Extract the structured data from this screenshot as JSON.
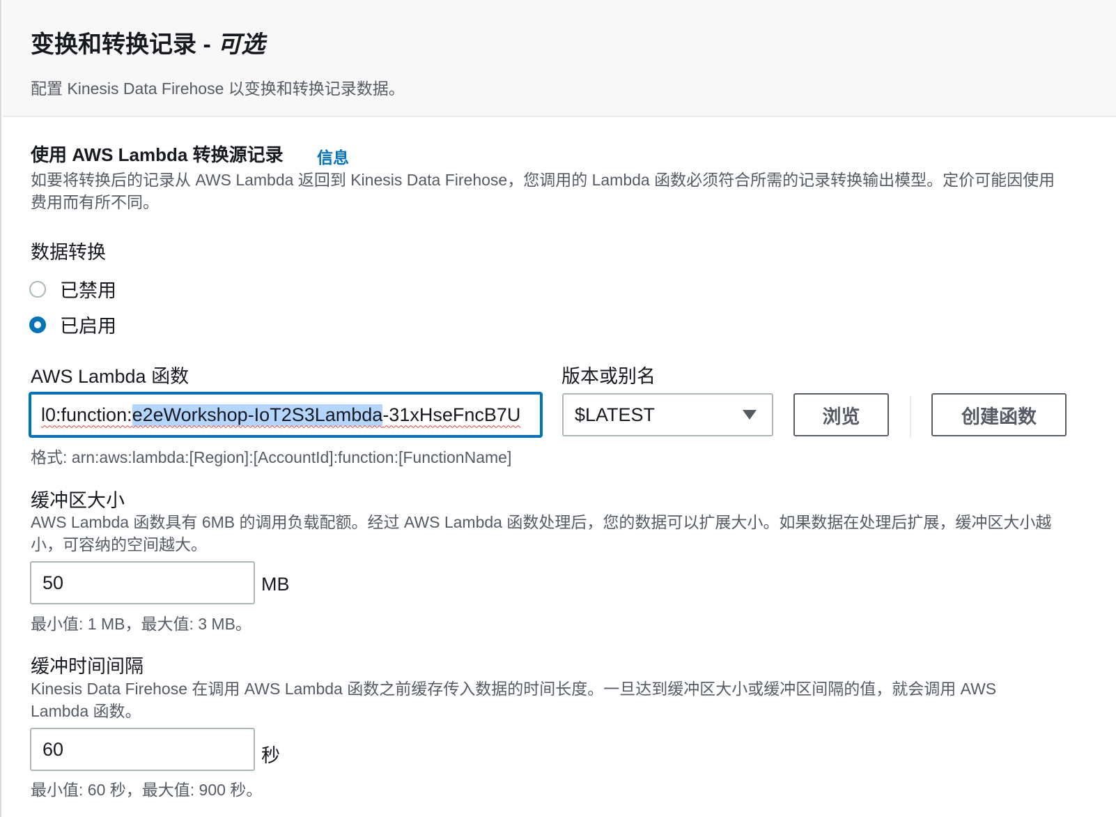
{
  "header": {
    "title": "变换和转换记录 - ",
    "title_optional": "可选",
    "description": "配置 Kinesis Data Firehose 以变换和转换记录数据。"
  },
  "lambda_section": {
    "title": "使用 AWS Lambda 转换源记录",
    "info_link": "信息",
    "description": "如要将转换后的记录从 AWS Lambda 返回到 Kinesis Data Firehose，您调用的 Lambda 函数必须符合所需的记录转换输出模型。定价可能因使用费用而有所不同。"
  },
  "data_transformation": {
    "label": "数据转换",
    "options": [
      {
        "label": "已禁用",
        "checked": false
      },
      {
        "label": "已启用",
        "checked": true
      }
    ]
  },
  "lambda_function": {
    "label": "AWS Lambda 函数",
    "value_prefix": "l0:function:",
    "value_selected": "e2eWorkshop-IoT2S3Lambda",
    "value_suffix": "-31xHseFncB7U",
    "hint": "格式: arn:aws:lambda:[Region]:[AccountId]:function:[FunctionName]"
  },
  "version": {
    "label": "版本或别名",
    "selected": "$LATEST"
  },
  "buttons": {
    "browse": "浏览",
    "create_function": "创建函数"
  },
  "buffer_size": {
    "label": "缓冲区大小",
    "description": "AWS Lambda 函数具有 6MB 的调用负载配额。经过 AWS Lambda 函数处理后，您的数据可以扩展大小。如果数据在处理后扩展，缓冲区大小越小，可容纳的空间越大。",
    "value": "50",
    "unit": "MB",
    "hint": "最小值: 1 MB，最大值: 3 MB。"
  },
  "buffer_interval": {
    "label": "缓冲时间间隔",
    "description": "Kinesis Data Firehose 在调用 AWS Lambda 函数之前缓存传入数据的时间长度。一旦达到缓冲区大小或缓冲区间隔的值，就会调用 AWS Lambda 函数。",
    "value": "60",
    "unit": "秒",
    "hint": "最小值: 60 秒，最大值: 900 秒。"
  },
  "colors": {
    "accent": "#0073bb",
    "text": "#16191f",
    "secondary_text": "#545b64",
    "border": "#aab7b8",
    "header_bg": "#f8f8f8",
    "selection": "#b4d5fe"
  }
}
